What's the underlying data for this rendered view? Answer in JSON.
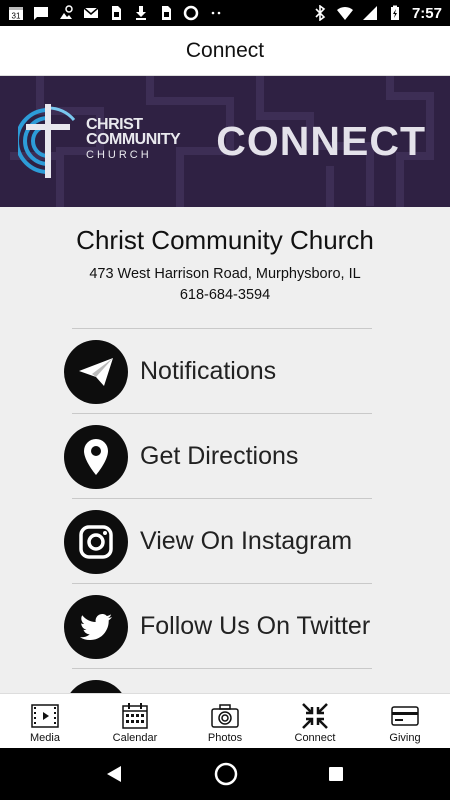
{
  "status_bar": {
    "time": "7:57",
    "left_icons": [
      "calendar-31-icon",
      "message-icon",
      "photo-sync-icon",
      "gmail-icon",
      "sim-icon",
      "download-icon",
      "sim-icon",
      "circle-icon",
      "more-dots-icon"
    ],
    "right_icons": [
      "bluetooth-icon",
      "wifi-icon",
      "signal-icon",
      "battery-charging-icon"
    ]
  },
  "header": {
    "title": "Connect"
  },
  "banner": {
    "church_line1": "CHRIST",
    "church_line2": "COMMUNITY",
    "church_line3": "CHURCH",
    "title": "CONNECT",
    "bg_color": "#2f2143"
  },
  "church": {
    "name": "Christ Community Church",
    "address": "473 West Harrison Road, Murphysboro, IL",
    "phone": "618-684-3594"
  },
  "actions": [
    {
      "label": "Notifications",
      "icon": "paper-plane-icon"
    },
    {
      "label": "Get Directions",
      "icon": "map-pin-icon"
    },
    {
      "label": "View On Instagram",
      "icon": "instagram-icon"
    },
    {
      "label": "Follow Us On Twitter",
      "icon": "twitter-icon"
    }
  ],
  "bottom_nav": [
    {
      "label": "Media",
      "icon": "film-icon"
    },
    {
      "label": "Calendar",
      "icon": "calendar-icon"
    },
    {
      "label": "Photos",
      "icon": "camera-icon"
    },
    {
      "label": "Connect",
      "icon": "arrows-inward-icon",
      "active": true
    },
    {
      "label": "Giving",
      "icon": "card-icon"
    }
  ],
  "system_nav": [
    "back-icon",
    "home-icon",
    "recents-icon"
  ]
}
